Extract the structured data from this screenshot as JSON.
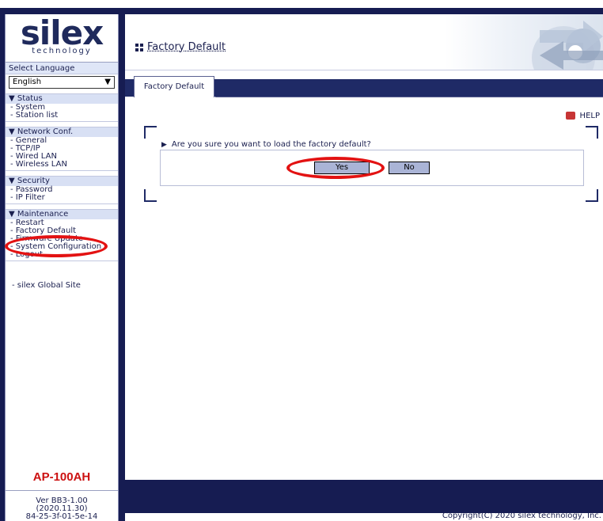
{
  "sidebar": {
    "logo_main": "silex",
    "logo_sub": "technology",
    "language_label": "Select Language",
    "language_value": "English",
    "sections": [
      {
        "title": "▼ Status",
        "items": [
          "- System",
          "- Station list"
        ]
      },
      {
        "title": "▼ Network Conf.",
        "items": [
          "- General",
          "- TCP/IP",
          "- Wired LAN",
          "- Wireless LAN"
        ]
      },
      {
        "title": "▼ Security",
        "items": [
          "- Password",
          "- IP Filter"
        ]
      },
      {
        "title": "▼ Maintenance",
        "items": [
          "- Restart",
          "- Factory Default",
          "- Firmware Update",
          "- System Configuration",
          "- Logout"
        ]
      }
    ],
    "global_link": "- silex Global Site",
    "model": "AP-100AH",
    "version_lines": [
      "Ver BB3-1.00",
      "(2020.11.30)",
      "84-25-3f-01-5e-14"
    ]
  },
  "header": {
    "title": "Factory Default"
  },
  "tab": {
    "label": "Factory Default"
  },
  "help_label": "HELP",
  "dialog": {
    "question": "Are you sure you want to load the factory default?",
    "yes_label": "Yes",
    "no_label": "No"
  },
  "footer": {
    "copyright": "Copyright(C) 2020 silex technology, Inc."
  },
  "colors": {
    "navy": "#161c52",
    "annotation_red": "#e31212",
    "model_red": "#cc1111"
  }
}
